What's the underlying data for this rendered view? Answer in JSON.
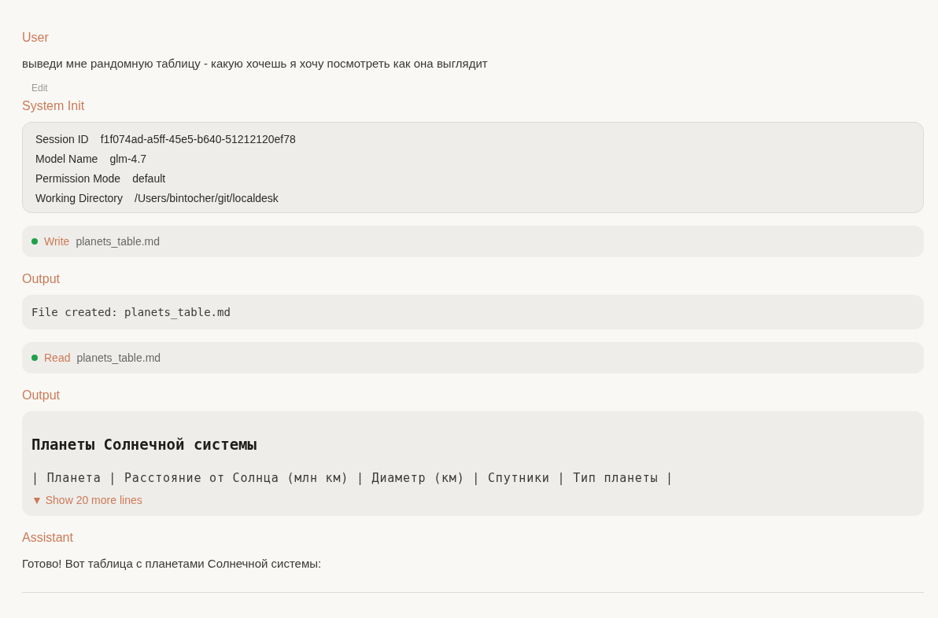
{
  "messages": [
    {
      "kind": "user",
      "label": "User",
      "text": "выведи мне рандомную таблицу - какую хочешь я хочу посмотреть как она выглядит",
      "action": "Edit"
    },
    {
      "kind": "system_init",
      "label": "System Init",
      "fields": [
        {
          "key": "Session ID",
          "value": "f1f074ad-a5ff-45e5-b640-51212120ef78"
        },
        {
          "key": "Model Name",
          "value": "glm-4.7"
        },
        {
          "key": "Permission Mode",
          "value": "default"
        },
        {
          "key": "Working Directory",
          "value": "/Users/bintocher/git/localdesk"
        }
      ]
    },
    {
      "kind": "tool",
      "color": "#22a04b",
      "tool": "Write",
      "file": "planets_table.md"
    },
    {
      "kind": "output",
      "label": "Output",
      "lines": [
        "File created: planets_table.md"
      ]
    },
    {
      "kind": "tool",
      "color": "#22a04b",
      "tool": "Read",
      "file": "planets_table.md"
    },
    {
      "kind": "output",
      "label": "Output",
      "heading": "Планеты Солнечной системы",
      "lines": [
        "| Планета | Расстояние от Солнца (млн км) | Диаметр (км) | Спутники | Тип планеты |"
      ],
      "more": "▼ Show 20 more lines"
    },
    {
      "kind": "assistant",
      "label": "Assistant",
      "text": "Готово! Вот таблица с планетами Солнечной системы:"
    }
  ]
}
